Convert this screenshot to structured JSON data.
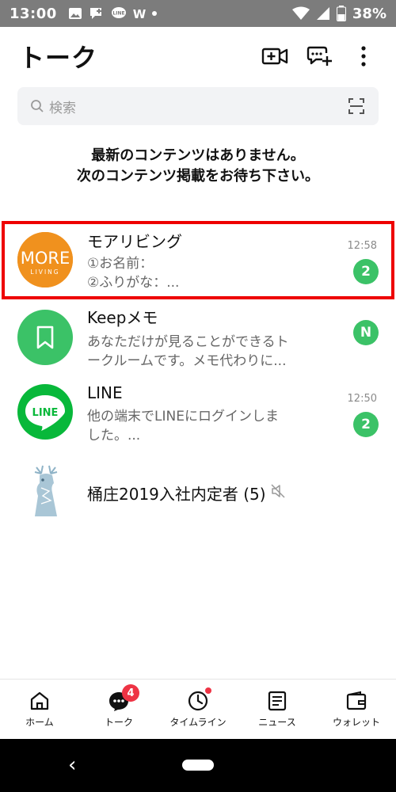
{
  "status_bar": {
    "time": "13:00",
    "battery": "38%",
    "icons": [
      "image-icon",
      "chat-plus-icon",
      "line-icon",
      "w-icon",
      "dot-icon"
    ],
    "right_icons": [
      "wifi-icon",
      "signal-icon",
      "battery-icon"
    ]
  },
  "header": {
    "title": "トーク",
    "actions": [
      "video-call-plus-icon",
      "chat-plus-icon",
      "more-vertical-icon"
    ]
  },
  "search": {
    "placeholder": "検索"
  },
  "notice": {
    "line1": "最新のコンテンツはありません。",
    "line2": "次のコンテンツ掲載をお待ち下さい。"
  },
  "chats": [
    {
      "name": "モアリビング",
      "preview_line1": "①お名前：",
      "preview_line2": "②ふりがな：...",
      "time": "12:58",
      "badge": "2",
      "avatar_text_top": "MORE",
      "avatar_text_bottom": "LIVING",
      "avatar_color": "#f0911e"
    },
    {
      "name": "Keepメモ",
      "preview_line1": "あなただけが見ることができるト",
      "preview_line2": "ークルームです。メモ代わりに...",
      "time": "",
      "badge": "N",
      "avatar_color": "#3bc267"
    },
    {
      "name": "LINE",
      "preview_line1": "他の端末でLINEにログインしま",
      "preview_line2": "した。...",
      "time": "12:50",
      "badge": "2",
      "avatar_text": "LINE",
      "avatar_color": "#08b83a"
    },
    {
      "name": "桶庄2019入社内定者 (5)",
      "muted": true
    }
  ],
  "bottom_nav": [
    {
      "label": "ホーム",
      "icon": "home-icon"
    },
    {
      "label": "トーク",
      "icon": "talk-icon",
      "badge": "4"
    },
    {
      "label": "タイムライン",
      "icon": "clock-icon",
      "dot": true
    },
    {
      "label": "ニュース",
      "icon": "news-icon"
    },
    {
      "label": "ウォレット",
      "icon": "wallet-icon"
    }
  ],
  "colors": {
    "accent_green": "#3bc267",
    "badge_red": "#ee3344",
    "highlight": "#ee0000"
  }
}
